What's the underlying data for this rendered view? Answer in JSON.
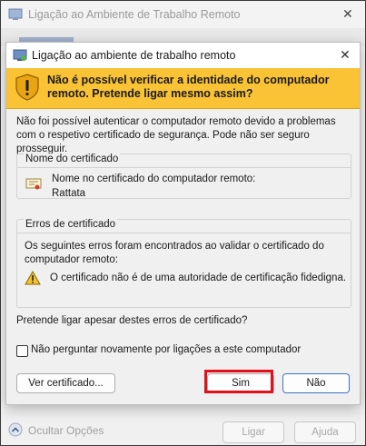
{
  "outer_window": {
    "title": "Ligação ao Ambiente de Trabalho Remoto",
    "close_glyph": "✕",
    "footer": {
      "toggle_label": "Ocultar Opções",
      "connect_label": "Ligar",
      "help_label": "Ajuda"
    }
  },
  "dialog": {
    "title": "Ligação ao ambiente de trabalho remoto",
    "close_glyph": "✕",
    "warning_heading": "Não é possível verificar a identidade do computador remoto. Pretende ligar mesmo assim?",
    "description": "Não foi possível autenticar o computador remoto devido a problemas com o respetivo certificado de segurança. Pode não ser seguro prosseguir.",
    "certificate_group": {
      "legend": "Nome do certificado",
      "label": "Nome no certificado do computador remoto:",
      "value": "Rattata"
    },
    "errors_group": {
      "legend": "Erros de certificado",
      "intro": "Os seguintes erros foram encontrados ao validar o certificado do computador remoto:",
      "error_text": "O certificado não é de uma autoridade de certificação fidedigna."
    },
    "question": "Pretende ligar apesar destes erros de certificado?",
    "checkbox_label": "Não perguntar novamente por ligações a este computador",
    "checkbox_checked": false,
    "buttons": {
      "view_cert": "Ver certificado...",
      "yes": "Sim",
      "no": "Não"
    }
  },
  "colors": {
    "warning_band": "#f9c335",
    "highlight": "#e3101b",
    "default_button_border": "#3b72c4"
  },
  "icons": [
    "rdp-app-icon",
    "warning-shield-icon",
    "certificate-icon",
    "warning-triangle-icon",
    "chevron-up-icon"
  ]
}
